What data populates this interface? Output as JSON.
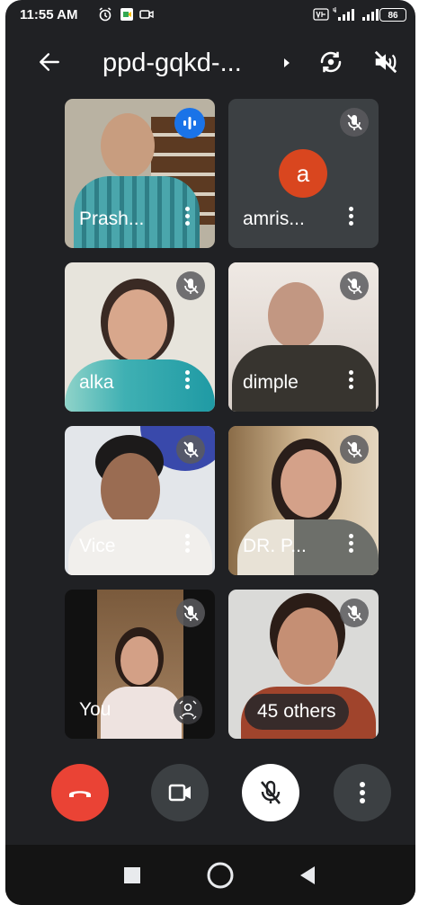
{
  "status_bar": {
    "time": "11:55 AM",
    "battery": "86"
  },
  "meeting": {
    "code": "ppd-gqkd-..."
  },
  "participants": [
    {
      "name": "Prash...",
      "speaking": true
    },
    {
      "name": "amris...",
      "avatar_letter": "a",
      "muted": true
    },
    {
      "name": "alka",
      "muted": true
    },
    {
      "name": "dimple",
      "muted": true
    },
    {
      "name": "Vice",
      "muted": true
    },
    {
      "name": "DR. P...",
      "muted": true
    },
    {
      "name": "You",
      "muted": true
    }
  ],
  "others": {
    "label": "45 others"
  },
  "colors": {
    "background": "#202124",
    "tile": "#3c4043",
    "end_call": "#ea4335",
    "avatar": "#d9461f",
    "speaking": "#1a73e8"
  }
}
